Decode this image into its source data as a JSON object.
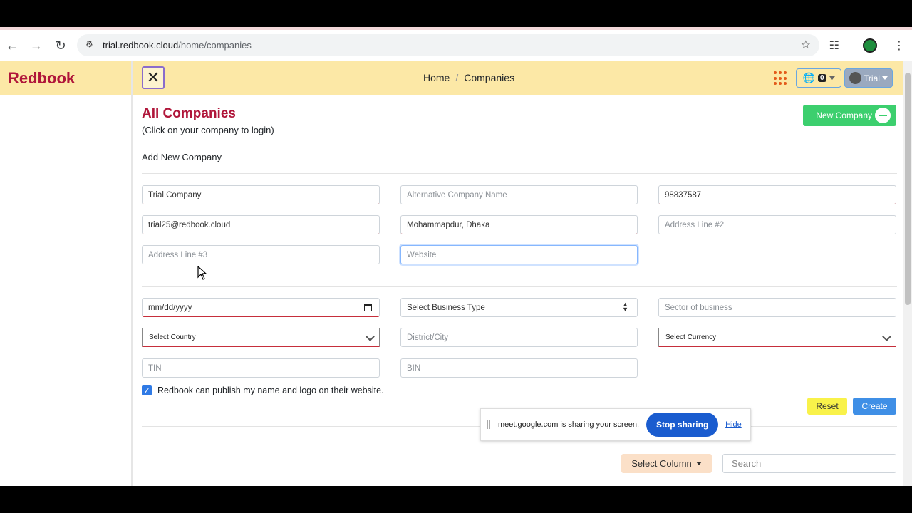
{
  "browser": {
    "url_host": "trial.redbook.cloud",
    "url_path": "/home/companies"
  },
  "sidebar": {
    "brand": "Redbook"
  },
  "header": {
    "breadcrumb": [
      "Home",
      "Companies"
    ],
    "notif_count": "0",
    "user_label": "Trial"
  },
  "main": {
    "title": "All Companies",
    "subtitle": "(Click on your company to login)",
    "new_company_label": "New Company",
    "section_title": "Add New Company"
  },
  "form": {
    "company_name": "Trial Company",
    "alt_company_name_placeholder": "Alternative Company Name",
    "phone": "98837587",
    "email": "trial25@redbook.cloud",
    "address1": "Mohammapdur, Dhaka",
    "address2_placeholder": "Address Line #2",
    "address3_placeholder": "Address Line #3",
    "website_placeholder": "Website",
    "date_placeholder": "mm/dd/yyyy",
    "business_type": "Select Business Type",
    "sector_placeholder": "Sector of business",
    "country": "Select Country",
    "district_placeholder": "District/City",
    "currency": "Select Currency",
    "tin_placeholder": "TIN",
    "bin_placeholder": "BIN",
    "publish_label": "Redbook can publish my name and logo on their website.",
    "reset_label": "Reset",
    "create_label": "Create"
  },
  "share_bar": {
    "text": "meet.google.com is sharing your screen.",
    "stop_label": "Stop sharing",
    "hide_label": "Hide"
  },
  "table_controls": {
    "select_column_label": "Select Column",
    "search_placeholder": "Search"
  }
}
